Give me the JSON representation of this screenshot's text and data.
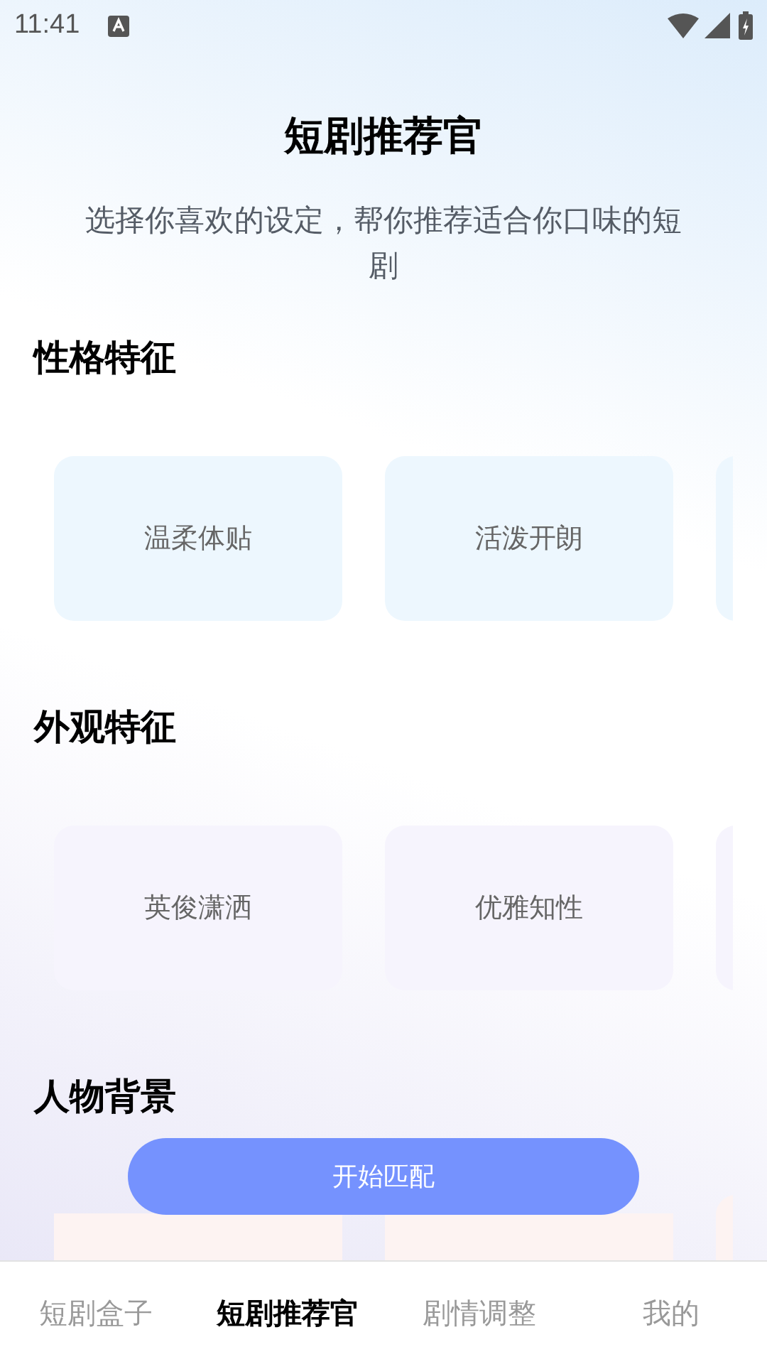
{
  "status_bar": {
    "time": "11:41"
  },
  "header": {
    "title": "短剧推荐官",
    "subtitle": "选择你喜欢的设定，帮你推荐适合你口味的短剧"
  },
  "sections": [
    {
      "title": "性格特征",
      "color": "#edf7fe",
      "options": [
        {
          "kind": "full",
          "label": "温柔体贴"
        },
        {
          "kind": "full",
          "label": "活泼开朗"
        },
        {
          "kind": "clipped"
        }
      ]
    },
    {
      "title": "外观特征",
      "color": "#f6f4fd",
      "options": [
        {
          "kind": "full",
          "label": "英俊潇洒"
        },
        {
          "kind": "full",
          "label": "优雅知性"
        },
        {
          "kind": "clipped"
        }
      ]
    },
    {
      "title": "人物背景",
      "color": "#fdf3f2",
      "options": [
        {
          "kind": "clipped"
        },
        {
          "kind": "clipped"
        },
        {
          "kind": "clipped"
        }
      ]
    }
  ],
  "match_button": {
    "label": "开始匹配"
  },
  "tabs": [
    {
      "label": "短剧盒子",
      "selected": false
    },
    {
      "label": "短剧推荐官",
      "selected": true
    },
    {
      "label": "剧情调整",
      "selected": false
    },
    {
      "label": "我的",
      "selected": false
    }
  ]
}
